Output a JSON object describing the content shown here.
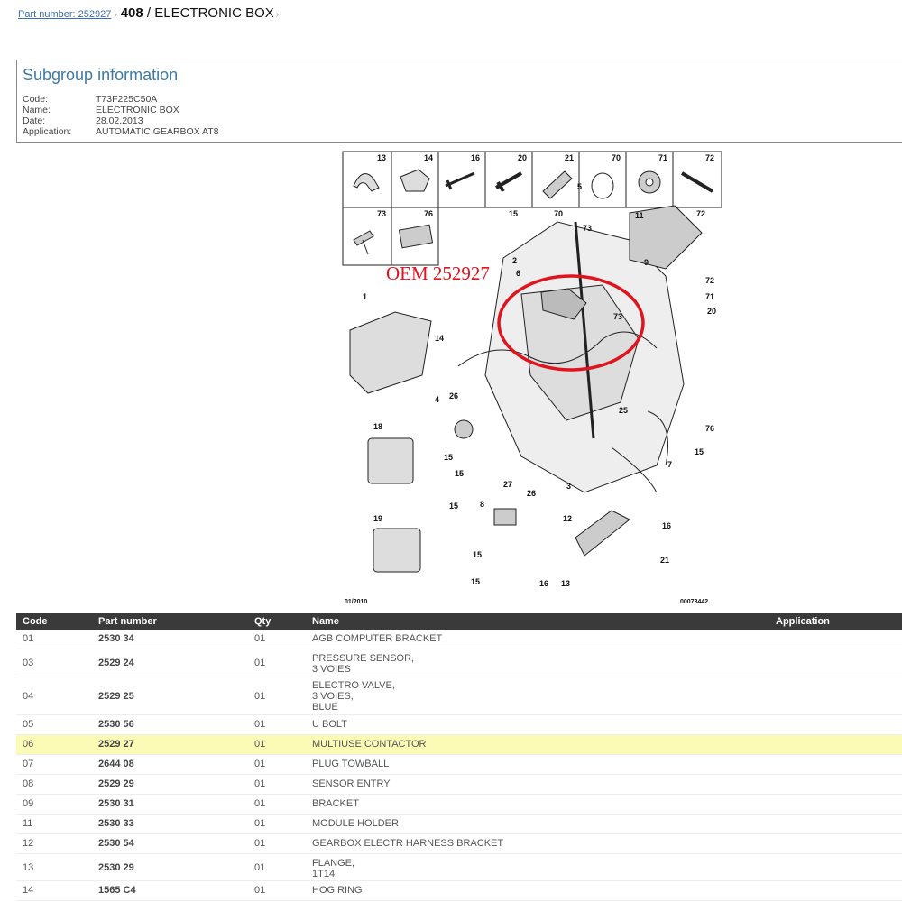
{
  "breadcrumb": {
    "part_link": "Part number: 252927",
    "model": "408",
    "slash": " / ",
    "group": "ELECTRONIC BOX",
    "sep": "›"
  },
  "subgroup": {
    "heading": "Subgroup information",
    "fields": [
      {
        "key": "Code:",
        "value": "T73F225C50A"
      },
      {
        "key": "Name:",
        "value": "ELECTRONIC BOX"
      },
      {
        "key": "Date:",
        "value": "28.02.2013"
      },
      {
        "key": "Application:",
        "value": "AUTOMATIC GEARBOX AT8"
      }
    ]
  },
  "diagram": {
    "watermark": "OEM 252927",
    "date_code": "01/2010",
    "ref_code": "00073442",
    "accent": "#e0141e",
    "inset_labels": [
      "13",
      "14",
      "16",
      "20",
      "21",
      "70",
      "71",
      "72",
      "73",
      "76"
    ],
    "callouts": [
      "1",
      "2",
      "4",
      "5",
      "6",
      "7",
      "8",
      "9",
      "11",
      "12",
      "14",
      "15",
      "15",
      "15",
      "15",
      "15",
      "15",
      "15",
      "16",
      "16",
      "18",
      "19",
      "20",
      "21",
      "25",
      "26",
      "26",
      "27",
      "70",
      "71",
      "72",
      "72",
      "73",
      "73",
      "76",
      "13",
      "3"
    ]
  },
  "table": {
    "headers": [
      "Code",
      "Part number",
      "Qty",
      "Name",
      "Application"
    ],
    "highlight_color": "#fbfbb6",
    "rows": [
      {
        "code": "01",
        "part": "2530 34",
        "qty": "01",
        "name": "AGB COMPUTER BRACKET",
        "app": ""
      },
      {
        "code": "03",
        "part": "2529 24",
        "qty": "01",
        "name": "PRESSURE SENSOR,\n3 VOIES",
        "app": ""
      },
      {
        "code": "04",
        "part": "2529 25",
        "qty": "01",
        "name": "ELECTRO VALVE,\n3 VOIES,\nBLUE",
        "app": ""
      },
      {
        "code": "05",
        "part": "2530 56",
        "qty": "01",
        "name": "U BOLT",
        "app": ""
      },
      {
        "code": "06",
        "part": "2529 27",
        "qty": "01",
        "name": "MULTIUSE CONTACTOR",
        "app": ""
      },
      {
        "code": "07",
        "part": "2644 08",
        "qty": "01",
        "name": "PLUG TOWBALL",
        "app": ""
      },
      {
        "code": "08",
        "part": "2529 29",
        "qty": "01",
        "name": "SENSOR ENTRY",
        "app": ""
      },
      {
        "code": "09",
        "part": "2530 31",
        "qty": "01",
        "name": "BRACKET",
        "app": ""
      },
      {
        "code": "11",
        "part": "2530 33",
        "qty": "01",
        "name": "MODULE HOLDER",
        "app": ""
      },
      {
        "code": "12",
        "part": "2530 54",
        "qty": "01",
        "name": "GEARBOX ELECTR HARNESS BRACKET",
        "app": ""
      },
      {
        "code": "13",
        "part": "2530 29",
        "qty": "01",
        "name": "FLANGE,\n1T14",
        "app": ""
      },
      {
        "code": "14",
        "part": "1565 C4",
        "qty": "01",
        "name": "HOG RING",
        "app": ""
      }
    ]
  }
}
